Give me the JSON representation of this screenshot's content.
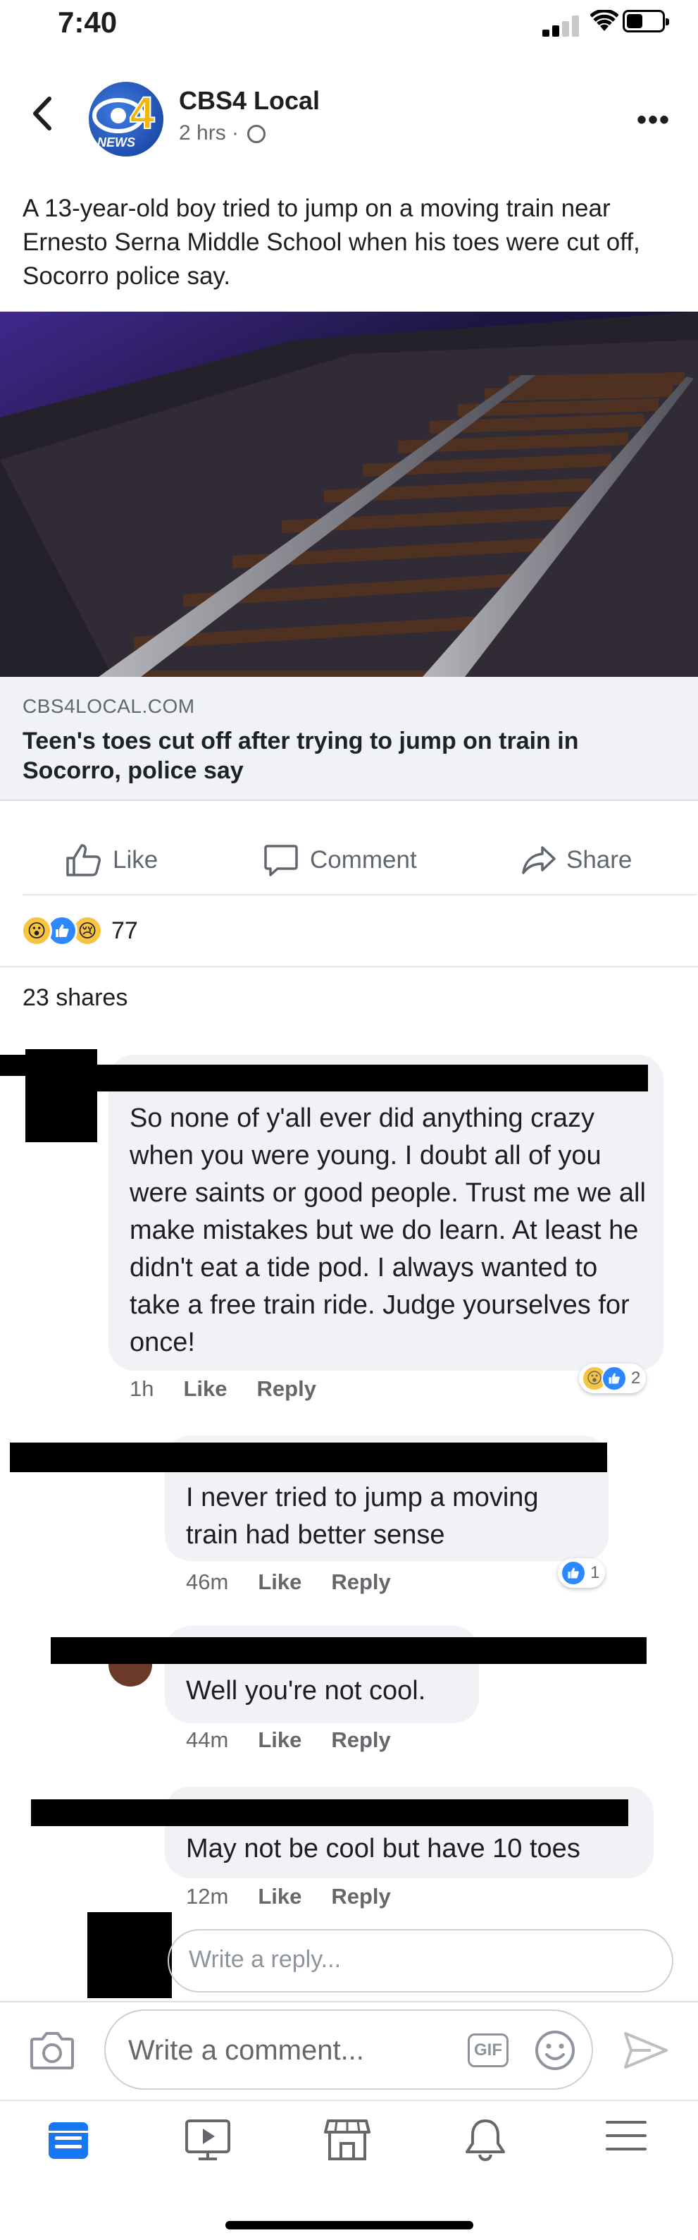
{
  "status_bar": {
    "time": "7:40",
    "battery_level": 0.45
  },
  "post": {
    "page_name": "CBS4 Local",
    "meta": "2 hrs ·",
    "avatar_text": "NEWS",
    "text": "A 13-year-old boy tried to jump on a moving train near Ernesto Serna Middle School when his toes were cut off, Socorro police say.",
    "link": {
      "domain": "CBS4LOCAL.COM",
      "title": "Teen's toes cut off after trying to jump on train in Socorro, police say"
    }
  },
  "actions": {
    "like": "Like",
    "comment": "Comment",
    "share": "Share"
  },
  "engagement": {
    "reaction_count": "77",
    "shares": "23 shares"
  },
  "comments": [
    {
      "text": "So none of y'all ever did anything crazy when you were young. I doubt all of you were saints or good people. Trust me we all make mistakes but we do learn. At least he didn't eat a tide pod. I always wanted to take a free train ride. Judge yourselves for once!",
      "time": "1h",
      "like": "Like",
      "reply": "Reply",
      "reaction_count": "2"
    },
    {
      "text": "I never tried to jump a moving train had better sense",
      "time": "46m",
      "like": "Like",
      "reply": "Reply",
      "reaction_count": "1"
    },
    {
      "text": "Well you're not cool.",
      "time": "44m",
      "like": "Like",
      "reply": "Reply"
    },
    {
      "text": "May not be cool but have 10 toes",
      "time": "12m",
      "like": "Like",
      "reply": "Reply"
    }
  ],
  "reply_input": {
    "placeholder": "Write a reply..."
  },
  "composer": {
    "placeholder": "Write a comment...",
    "gif_label": "GIF"
  },
  "colors": {
    "facebook_blue": "#1877f2",
    "like_blue": "#2d88ff",
    "text_gray": "#65676b"
  },
  "tabbar": {
    "icons": [
      "news-feed-icon",
      "watch-icon",
      "marketplace-icon",
      "notifications-icon",
      "menu-icon"
    ],
    "active": "news-feed-icon"
  }
}
